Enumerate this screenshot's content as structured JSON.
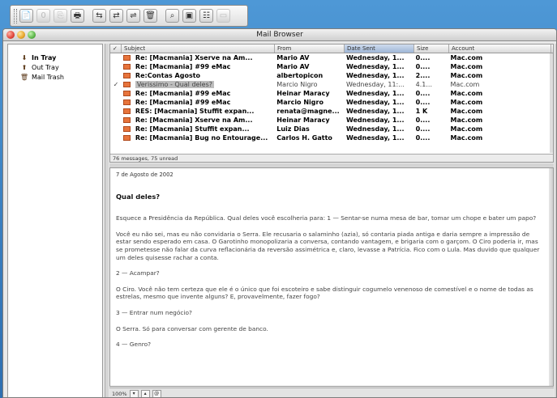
{
  "window": {
    "title": "Mail Browser"
  },
  "toolbar": {
    "buttons": [
      {
        "name": "new-message",
        "icon": "📄",
        "enabled": true
      },
      {
        "name": "reply",
        "icon": "0",
        "enabled": false
      },
      {
        "name": "forward",
        "icon": "⎘",
        "enabled": false
      },
      {
        "name": "print",
        "icon": "🖶",
        "enabled": true
      },
      {
        "name": "get-mail",
        "icon": "⇆",
        "enabled": true
      },
      {
        "name": "send-mail",
        "icon": "⇄",
        "enabled": true
      },
      {
        "name": "check-mail",
        "icon": "⇌",
        "enabled": true
      },
      {
        "name": "trash",
        "icon": "🗑",
        "enabled": true
      },
      {
        "name": "find",
        "icon": "⌕",
        "enabled": true
      },
      {
        "name": "address-book",
        "icon": "▣",
        "enabled": true
      },
      {
        "name": "preferences",
        "icon": "☷",
        "enabled": true
      },
      {
        "name": "hide",
        "icon": "▭",
        "enabled": false
      }
    ]
  },
  "mailboxes": [
    {
      "label": "In Tray",
      "icon": "⬇",
      "selected": true
    },
    {
      "label": "Out Tray",
      "icon": "⬆",
      "selected": false
    },
    {
      "label": "Mail Trash",
      "icon": "🗑",
      "selected": false
    }
  ],
  "list": {
    "columns": {
      "check": "✓",
      "subject": "Subject",
      "from": "From",
      "date": "Date Sent",
      "size": "Size",
      "account": "Account"
    },
    "rows": [
      {
        "check": "",
        "subject": "Re: [Macmania] Xserve na Am...",
        "from": "Mario AV",
        "date": "Wednesday, 1...",
        "size": "0....",
        "account": "Mac.com",
        "unread": true,
        "selected": false
      },
      {
        "check": "",
        "subject": "Re: [Macmania] #99 eMac",
        "from": "Mario AV",
        "date": "Wednesday, 1...",
        "size": "0....",
        "account": "Mac.com",
        "unread": true,
        "selected": false
      },
      {
        "check": "",
        "subject": "Re:Contas Agosto",
        "from": "albertopicon",
        "date": "Wednesday, 1...",
        "size": "2....",
        "account": "Mac.com",
        "unread": true,
        "selected": false
      },
      {
        "check": "✓",
        "subject": "Verissimo - Qual deles?",
        "from": "Marcio Nigro",
        "date": "Wednesday, 11:...",
        "size": "4.1...",
        "account": "Mac.com",
        "unread": false,
        "selected": true
      },
      {
        "check": "",
        "subject": "Re: [Macmania] #99 eMac",
        "from": "Heinar Maracy",
        "date": "Wednesday, 1...",
        "size": "0....",
        "account": "Mac.com",
        "unread": true,
        "selected": false
      },
      {
        "check": "",
        "subject": "Re: [Macmania] #99 eMac",
        "from": "Marcio Nigro",
        "date": "Wednesday, 1...",
        "size": "0....",
        "account": "Mac.com",
        "unread": true,
        "selected": false
      },
      {
        "check": "",
        "subject": "RES: [Macmania] Stuffit expan...",
        "from": "renata@magne...",
        "date": "Wednesday, 1...",
        "size": "1 K",
        "account": "Mac.com",
        "unread": true,
        "selected": false
      },
      {
        "check": "",
        "subject": "Re: [Macmania] Xserve na Am...",
        "from": "Heinar Maracy",
        "date": "Wednesday, 1...",
        "size": "0....",
        "account": "Mac.com",
        "unread": true,
        "selected": false
      },
      {
        "check": "",
        "subject": "Re: [Macmania] Stuffit expan...",
        "from": "Luiz Dias",
        "date": "Wednesday, 1...",
        "size": "0....",
        "account": "Mac.com",
        "unread": true,
        "selected": false
      },
      {
        "check": "",
        "subject": "Re: [Macmania] Bug no Entourage...",
        "from": "Carlos H. Gatto",
        "date": "Wednesday, 1...",
        "size": "0....",
        "account": "Mac.com",
        "unread": true,
        "selected": false
      }
    ],
    "status": "76 messages, 75 unread"
  },
  "message": {
    "date": "7 de Agosto de 2002",
    "subject": "Qual deles?",
    "paragraphs": [
      "Esquece a Presidência da República. Qual deles você escolheria para: 1 — Sentar-se numa mesa de bar, tomar um chope e bater um papo?",
      "Você eu não sei, mas eu não convidaria o Serra. Ele recusaria o salaminho (azia), só contaria piada antiga e daria sempre a impressão de estar sendo esperado em casa. O Garotinho monopolizaria a conversa, contando vantagem, e brigaria com o garçom. O Ciro poderia ir, mas se prometesse não falar da curva reflacionária da reversão assimétrica e, claro, levasse a Patrícia. Fico com o Lula. Mas duvido que qualquer um deles quisesse rachar a conta.",
      "2 — Acampar?",
      "O Ciro. Você não tem certeza que ele é o único que foi escoteiro e sabe distinguir cogumelo venenoso de comestível e o nome de todas as estrelas, mesmo que invente alguns? E, provavelmente, fazer fogo?",
      "3 — Entrar num negócio?",
      "O Serra. Só para conversar com gerente de banco.",
      "4 — Genro?"
    ]
  },
  "footer": {
    "zoom": "100%"
  }
}
